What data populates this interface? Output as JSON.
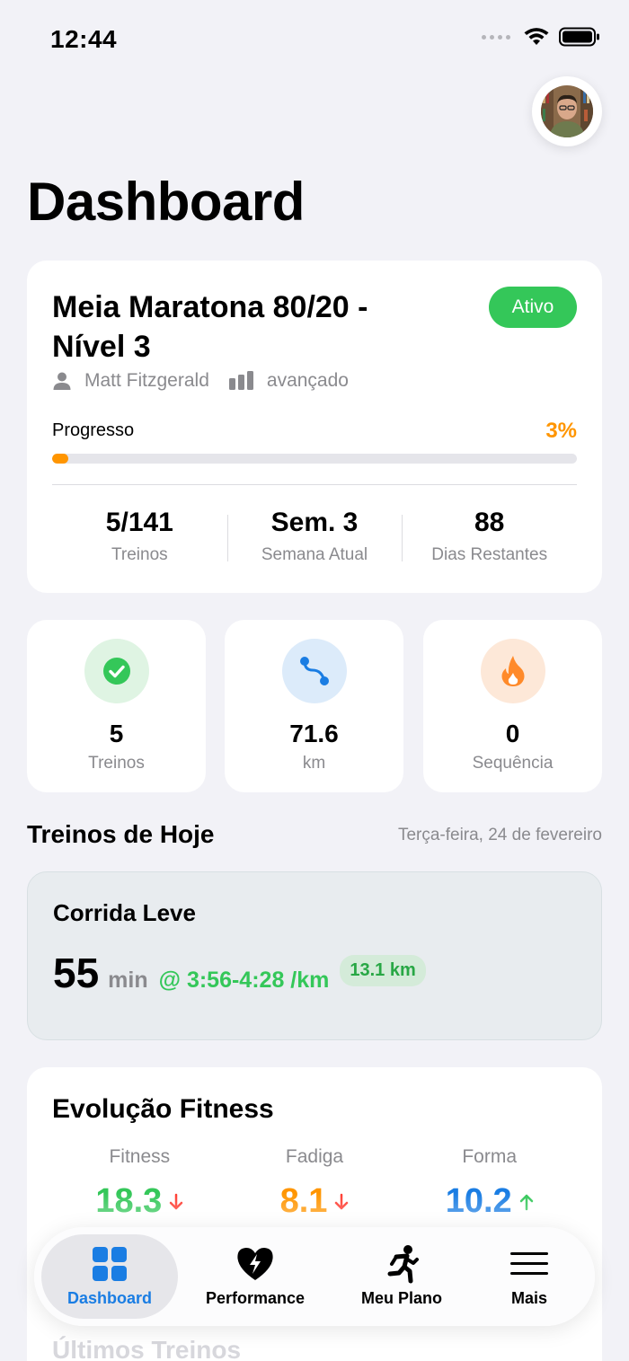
{
  "status_bar": {
    "time": "12:44"
  },
  "header": {
    "title": "Dashboard"
  },
  "plan": {
    "title": "Meia Maratona 80/20 - Nível 3",
    "status_badge": "Ativo",
    "author": "Matt Fitzgerald",
    "level": "avançado",
    "progress_label": "Progresso",
    "progress_percent": "3%",
    "progress_value": 0.03,
    "stats": [
      {
        "value": "5/141",
        "label": "Treinos"
      },
      {
        "value": "Sem. 3",
        "label": "Semana Atual"
      },
      {
        "value": "88",
        "label": "Dias Restantes"
      }
    ]
  },
  "summary": [
    {
      "icon": "checkmark-circle-icon",
      "value": "5",
      "label": "Treinos",
      "color": "#34c759",
      "bg": "#dff4e3"
    },
    {
      "icon": "route-icon",
      "value": "71.6",
      "label": "km",
      "color": "#1a7de3",
      "bg": "#dcebfa"
    },
    {
      "icon": "flame-icon",
      "value": "0",
      "label": "Sequência",
      "color": "#ff8a2a",
      "bg": "#fde8d8"
    }
  ],
  "today": {
    "title": "Treinos de Hoje",
    "date": "Terça-feira, 24 de fevereiro",
    "workout": {
      "name": "Corrida Leve",
      "duration": "55",
      "unit": "min",
      "pace": "@ 3:56-4:28 /km",
      "distance": "13.1 km"
    }
  },
  "fitness": {
    "title": "Evolução Fitness",
    "metrics": [
      {
        "label": "Fitness",
        "value": "18.3",
        "trend": "down",
        "color": "#34c759"
      },
      {
        "label": "Fadiga",
        "value": "8.1",
        "trend": "down",
        "color": "#ff9500"
      },
      {
        "label": "Forma",
        "value": "10.2",
        "trend": "up",
        "color": "#1a7de3"
      }
    ]
  },
  "next_section_title": "Últimos Treinos",
  "tab_bar": {
    "items": [
      {
        "label": "Dashboard",
        "icon": "grid-icon",
        "active": true
      },
      {
        "label": "Performance",
        "icon": "heart-bolt-icon",
        "active": false
      },
      {
        "label": "Meu Plano",
        "icon": "runner-icon",
        "active": false
      },
      {
        "label": "Mais",
        "icon": "menu-icon",
        "active": false
      }
    ]
  },
  "colors": {
    "accent": "#1a7de3",
    "success": "#34c759",
    "warning": "#ff9500",
    "danger": "#ff3b30",
    "background": "#f2f2f7"
  }
}
